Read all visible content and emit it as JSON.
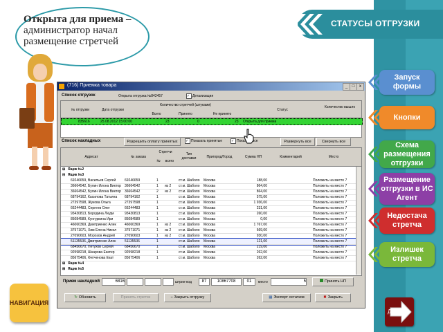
{
  "bubble": {
    "title": "Открыта для приема –",
    "line2": "администратор начал",
    "line3": "размещение стретчей"
  },
  "header": {
    "title": "СТАТУСЫ ОТГРУЗКИ"
  },
  "side_buttons": [
    {
      "label": "Запуск формы",
      "color": "#5a8fd0"
    },
    {
      "label": "Кнопки",
      "color": "#f08a2a"
    },
    {
      "label": "Схема размещения отгрузки",
      "color": "#42a84a"
    },
    {
      "label": "Размещение отгрузки в ИС Агент",
      "color": "#8d3fa6"
    },
    {
      "label": "Недостача стретча",
      "color": "#cf2e2e"
    },
    {
      "label": "Излишек стретча",
      "color": "#7ab83a"
    }
  ],
  "nav": {
    "label": "НАВИГАЦИЯ",
    "next": "Далее"
  },
  "window": {
    "title": "(716) Приемка товара",
    "ship_list_label": "Список отгрузок",
    "ship_open": "Открыта отгрузка №842457",
    "detail_cb": "Детализация",
    "ship_headers": {
      "num": "№ отгрузки",
      "date": "Дата отгрузки",
      "qty": "Количество стретчей (штуками)",
      "total": "Всего",
      "accepted": "Принято",
      "not_accepted": "Не принято",
      "status": "Статус",
      "qty_out": "Количество вышло"
    },
    "ship_row": {
      "num": "835616",
      "date": "25.08.2012 15:00:00",
      "total": "23",
      "accepted": "0",
      "not_accepted": "23",
      "status": "Открыта для приема"
    },
    "invoices_label": "Список накладных",
    "allow_btn": "Разрешить оплату принятых",
    "show_accepted": "Показать принятые",
    "show_all": "Показать все",
    "expand_btn": "Развернуть все",
    "collapse_btn": "Свернуть все",
    "inv_headers": {
      "address": "Адресат",
      "order": "№ заказа",
      "stretch": "Стретчи",
      "num": "№",
      "total": "всего",
      "delivery": "Тип доставки",
      "city": "Пригород/Город",
      "sum": "Сумма НП",
      "comment": "Комментарий",
      "place": "Место"
    },
    "groups": [
      "Ящик №2",
      "Ящик №3",
      "Ящик №4",
      "Ящик №5"
    ],
    "rows": [
      {
        "addr": "69246659, Васильев Сергей",
        "order": "69246659",
        "n": "1",
        "t": "",
        "del": "ст.м. Шаболо",
        "city": "Москва",
        "sum": "188,00",
        "place": "Положить на место 7"
      },
      {
        "addr": "36664542, Булин Илона Виктор",
        "order": "36664542",
        "n": "1",
        "t": "из 2",
        "del": "ст.м. Шаболо",
        "city": "Москва",
        "sum": "864,00",
        "place": "Положить на место 7"
      },
      {
        "addr": "36664542, Булин Илона Виктор",
        "order": "36664542",
        "n": "2",
        "t": "из 2",
        "del": "ст.м. Шаболо",
        "city": "Москва",
        "sum": "864,00",
        "place": "Положить на место 7"
      },
      {
        "addr": "68794162, Касилова Татьяна",
        "order": "68794162",
        "n": "1",
        "t": "",
        "del": "ст.м. Шаболо",
        "city": "Москва",
        "sum": "575,00",
        "place": "Положить на место 7"
      },
      {
        "addr": "27397598, Жукова Ольга",
        "order": "27397598",
        "n": "1",
        "t": "",
        "del": "ст.м. Шаболо",
        "city": "Москва",
        "sum": "1 936,00",
        "place": "Положить на место 7"
      },
      {
        "addr": "66244483, Сергеев Олег",
        "order": "66244483",
        "n": "1",
        "t": "",
        "del": "ст.м. Шаболо",
        "city": "Москва",
        "sum": "231,00",
        "place": "Положить на место 7"
      },
      {
        "addr": "93430813, Бородина Людм",
        "order": "93430813",
        "n": "1",
        "t": "",
        "del": "ст.м. Шаболо",
        "city": "Москва",
        "sum": "260,00",
        "place": "Положить на место 7"
      },
      {
        "addr": "85084589, Кунгуркина Ири",
        "order": "85084589",
        "n": "1",
        "t": "",
        "del": "ст.м. Шаболо",
        "city": "Москва",
        "sum": "0,00",
        "place": "Положить на место 7"
      },
      {
        "addr": "46060369, Дмитриенко Алек",
        "order": "46060369",
        "n": "1",
        "t": "из 2",
        "del": "ст.м. Шаболо",
        "city": "Москва",
        "sum": "1 767,00",
        "place": "Положить на место 7"
      },
      {
        "addr": "37571071, Хим Елена Никол",
        "order": "37571071",
        "n": "1",
        "t": "из 2",
        "del": "ст.м. Шаболо",
        "city": "Москва",
        "sum": "669,00",
        "place": "Положить на место 7"
      },
      {
        "addr": "27090603, Морозов Андрей",
        "order": "27090603",
        "n": "1",
        "t": "из 2",
        "del": "ст.м. Шаболо",
        "city": "Москва",
        "sum": "930,00",
        "place": "Положить на место 7"
      },
      {
        "addr": "51135536, Дмитриенко Алек",
        "order": "51135536",
        "n": "1",
        "t": "",
        "del": "ст.м. Шаболо",
        "city": "Москва",
        "sum": "121,00",
        "place": "Положить на место 7"
      },
      {
        "addr": "68456670, Петухов Сергей",
        "order": "68456670",
        "n": "1",
        "t": "",
        "del": "ст.м. Шаболо",
        "city": "Москва",
        "sum": "219,00",
        "place": "Положить на место 7"
      },
      {
        "addr": "92598218, Шнарова Екатер",
        "order": "92598218",
        "n": "1",
        "t": "",
        "del": "ст.м. Шаболо",
        "city": "Москва",
        "sum": "262,00",
        "place": "Положить на место 7"
      },
      {
        "addr": "85675406, Фитченова Екат",
        "order": "85675406",
        "n": "1",
        "t": "",
        "del": "ст.м. Шаболо",
        "city": "Москва",
        "sum": "262,00",
        "place": "Положить на место 7"
      }
    ],
    "bottom": {
      "label": "Прием накладной",
      "v1": "6816",
      "barcode_label": "штрих-код",
      "v2": "87",
      "v3": "10867708",
      "v4": "01",
      "place_label": "место",
      "v5": "5",
      "accept_np": "Принять НП"
    },
    "buttons": {
      "refresh": "Обновить",
      "accept": "Принять стретчи",
      "close": "Закрыть отгрузку",
      "export": "Экспорт остатков",
      "close_win": "Закрыть"
    }
  }
}
